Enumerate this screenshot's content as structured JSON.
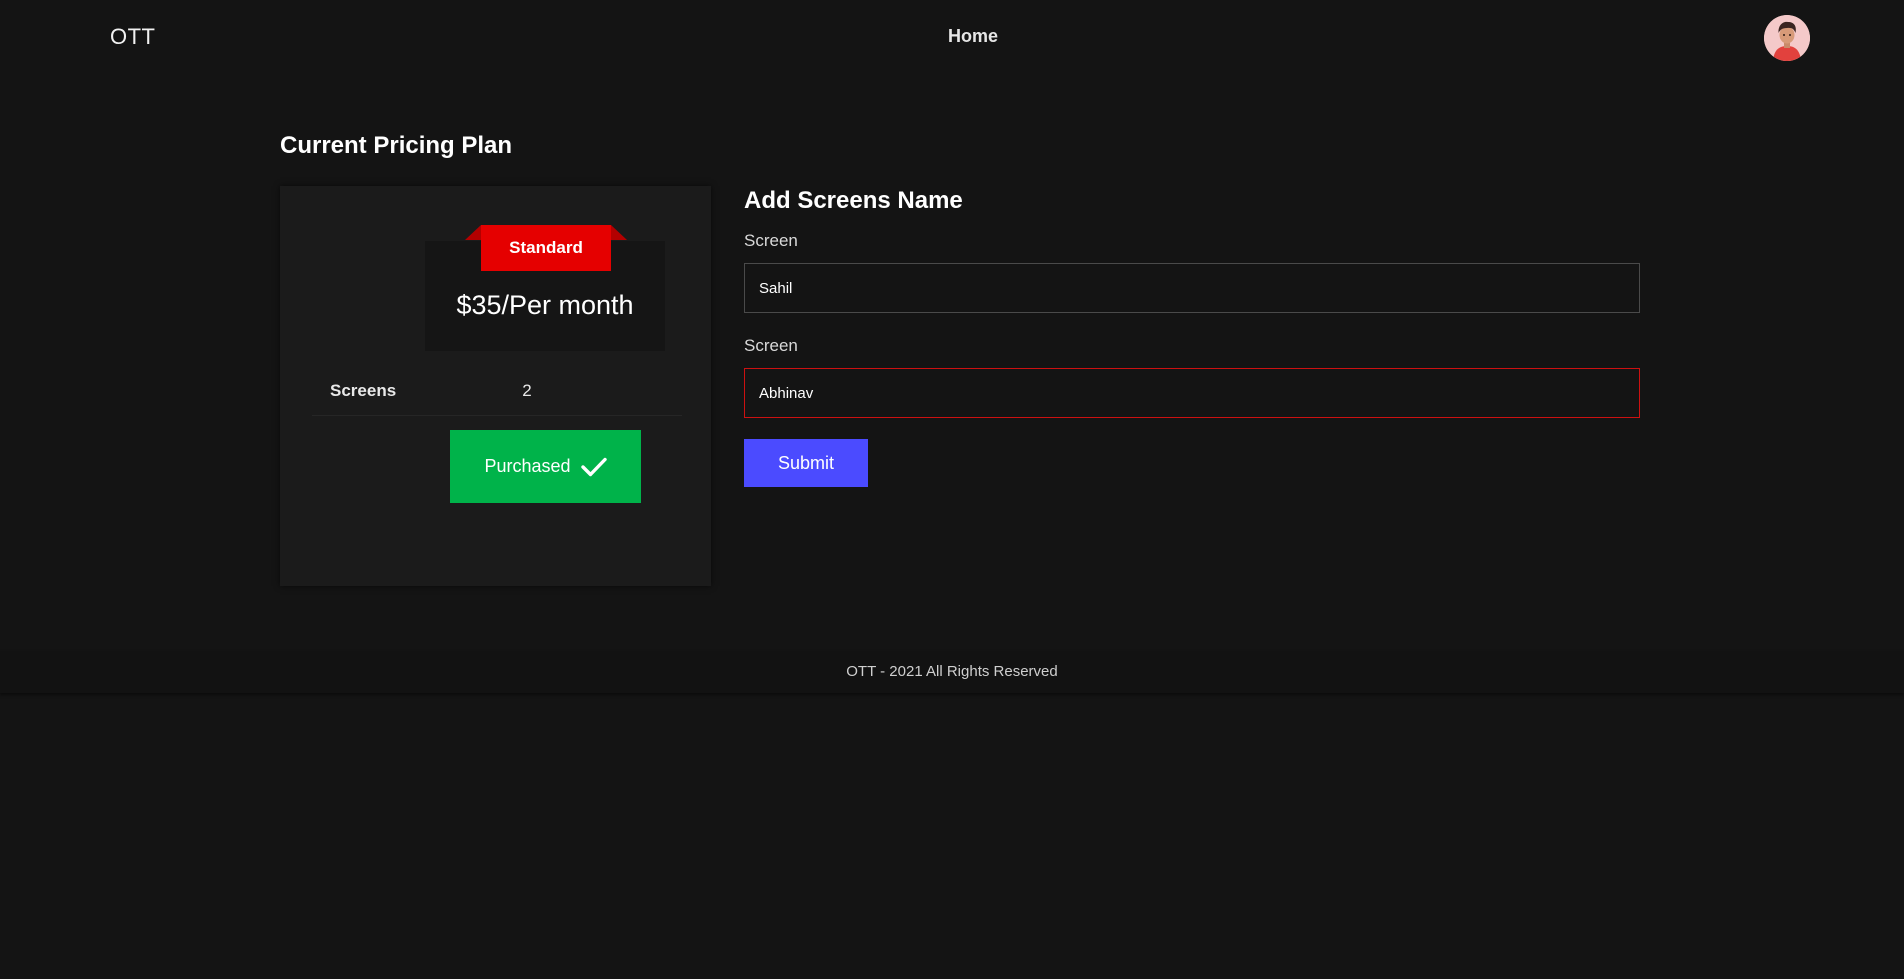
{
  "header": {
    "brand": "OTT",
    "nav_home": "Home"
  },
  "plan": {
    "section_title": "Current Pricing Plan",
    "badge": "Standard",
    "price": "$35/Per month",
    "screens_label": "Screens",
    "screens_value": "2",
    "purchased_label": "Purchased",
    "icons": {
      "check": "check-icon"
    },
    "colors": {
      "badge": "#e50000",
      "purchased": "#00b34a"
    }
  },
  "form": {
    "title": "Add Screens Name",
    "fields": [
      {
        "label": "Screen",
        "value": "Sahil"
      },
      {
        "label": "Screen",
        "value": "Abhinav"
      }
    ],
    "submit_label": "Submit",
    "colors": {
      "submit": "#4b4bff",
      "error_border": "#cc1111"
    }
  },
  "footer": {
    "text": "OTT - 2021 All Rights Reserved"
  }
}
